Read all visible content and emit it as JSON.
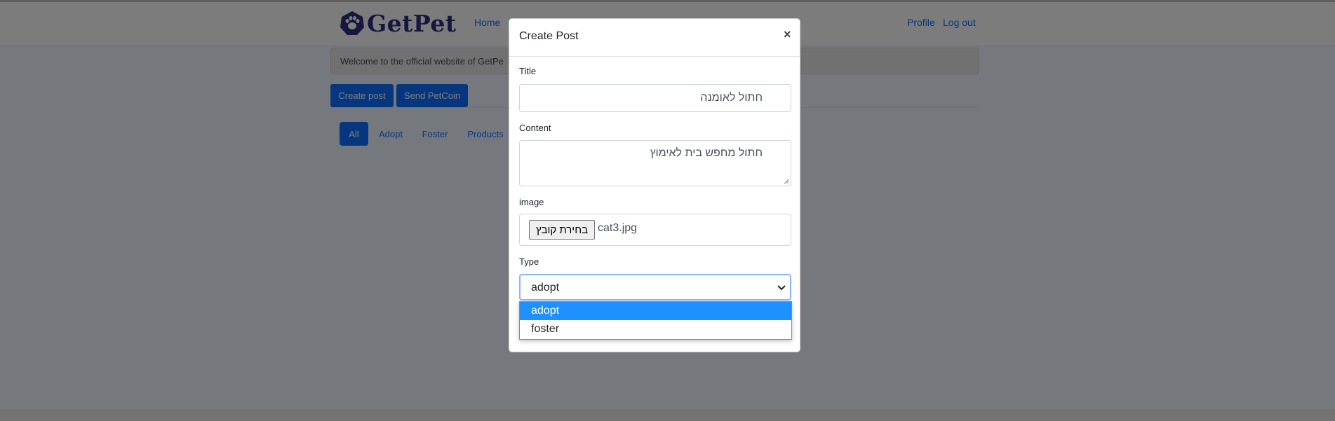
{
  "brand": {
    "name": "GetPet",
    "logo_icon": "paw-icon"
  },
  "nav": {
    "home": "Home",
    "profile": "Profile",
    "logout": "Log out"
  },
  "welcome_text": "Welcome to the official website of GetPe",
  "actions": {
    "create_post": "Create post",
    "send_petcoin": "Send PetCoin"
  },
  "filters": [
    "All",
    "Adopt",
    "Foster",
    "Products"
  ],
  "modal": {
    "title": "Create Post",
    "close": "×",
    "fields": {
      "title_label": "Title",
      "title_value": "חתול לאומנה",
      "content_label": "Content",
      "content_value": "חתול מחפש בית לאימוץ",
      "image_label": "image",
      "file_button": "בחירת קובץ",
      "file_name": "cat3.jpg",
      "type_label": "Type",
      "type_value": "adopt"
    },
    "type_options": [
      "adopt",
      "foster"
    ]
  },
  "colors": {
    "primary": "#0d6efd",
    "brand": "#2f2c7a",
    "option_highlight": "#1e90ff",
    "focus_ring": "#86b7fe"
  }
}
